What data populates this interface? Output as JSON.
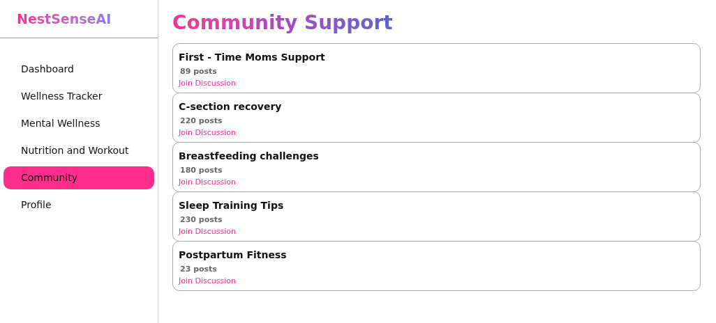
{
  "sidebar": {
    "logo": "NestSenseAI",
    "items": [
      {
        "label": "Dashboard",
        "selected": false
      },
      {
        "label": "Wellness Tracker",
        "selected": false
      },
      {
        "label": "Mental Wellness",
        "selected": false
      },
      {
        "label": "Nutrition and Workout",
        "selected": false
      },
      {
        "label": "Community",
        "selected": true
      },
      {
        "label": "Profile",
        "selected": false
      }
    ]
  },
  "page": {
    "title": "Community Support",
    "groups": [
      {
        "name": "First - Time Moms Support",
        "posts": "89 posts",
        "action": "Join Discussion"
      },
      {
        "name": "C-section recovery",
        "posts": "220 posts",
        "action": "Join Discussion"
      },
      {
        "name": "Breastfeeding challenges",
        "posts": "180 posts",
        "action": "Join Discussion"
      },
      {
        "name": "Sleep Training Tips",
        "posts": "230 posts",
        "action": "Join Discussion"
      },
      {
        "name": "Postpartum Fitness",
        "posts": "23 posts",
        "action": "Join Discussion"
      }
    ]
  }
}
